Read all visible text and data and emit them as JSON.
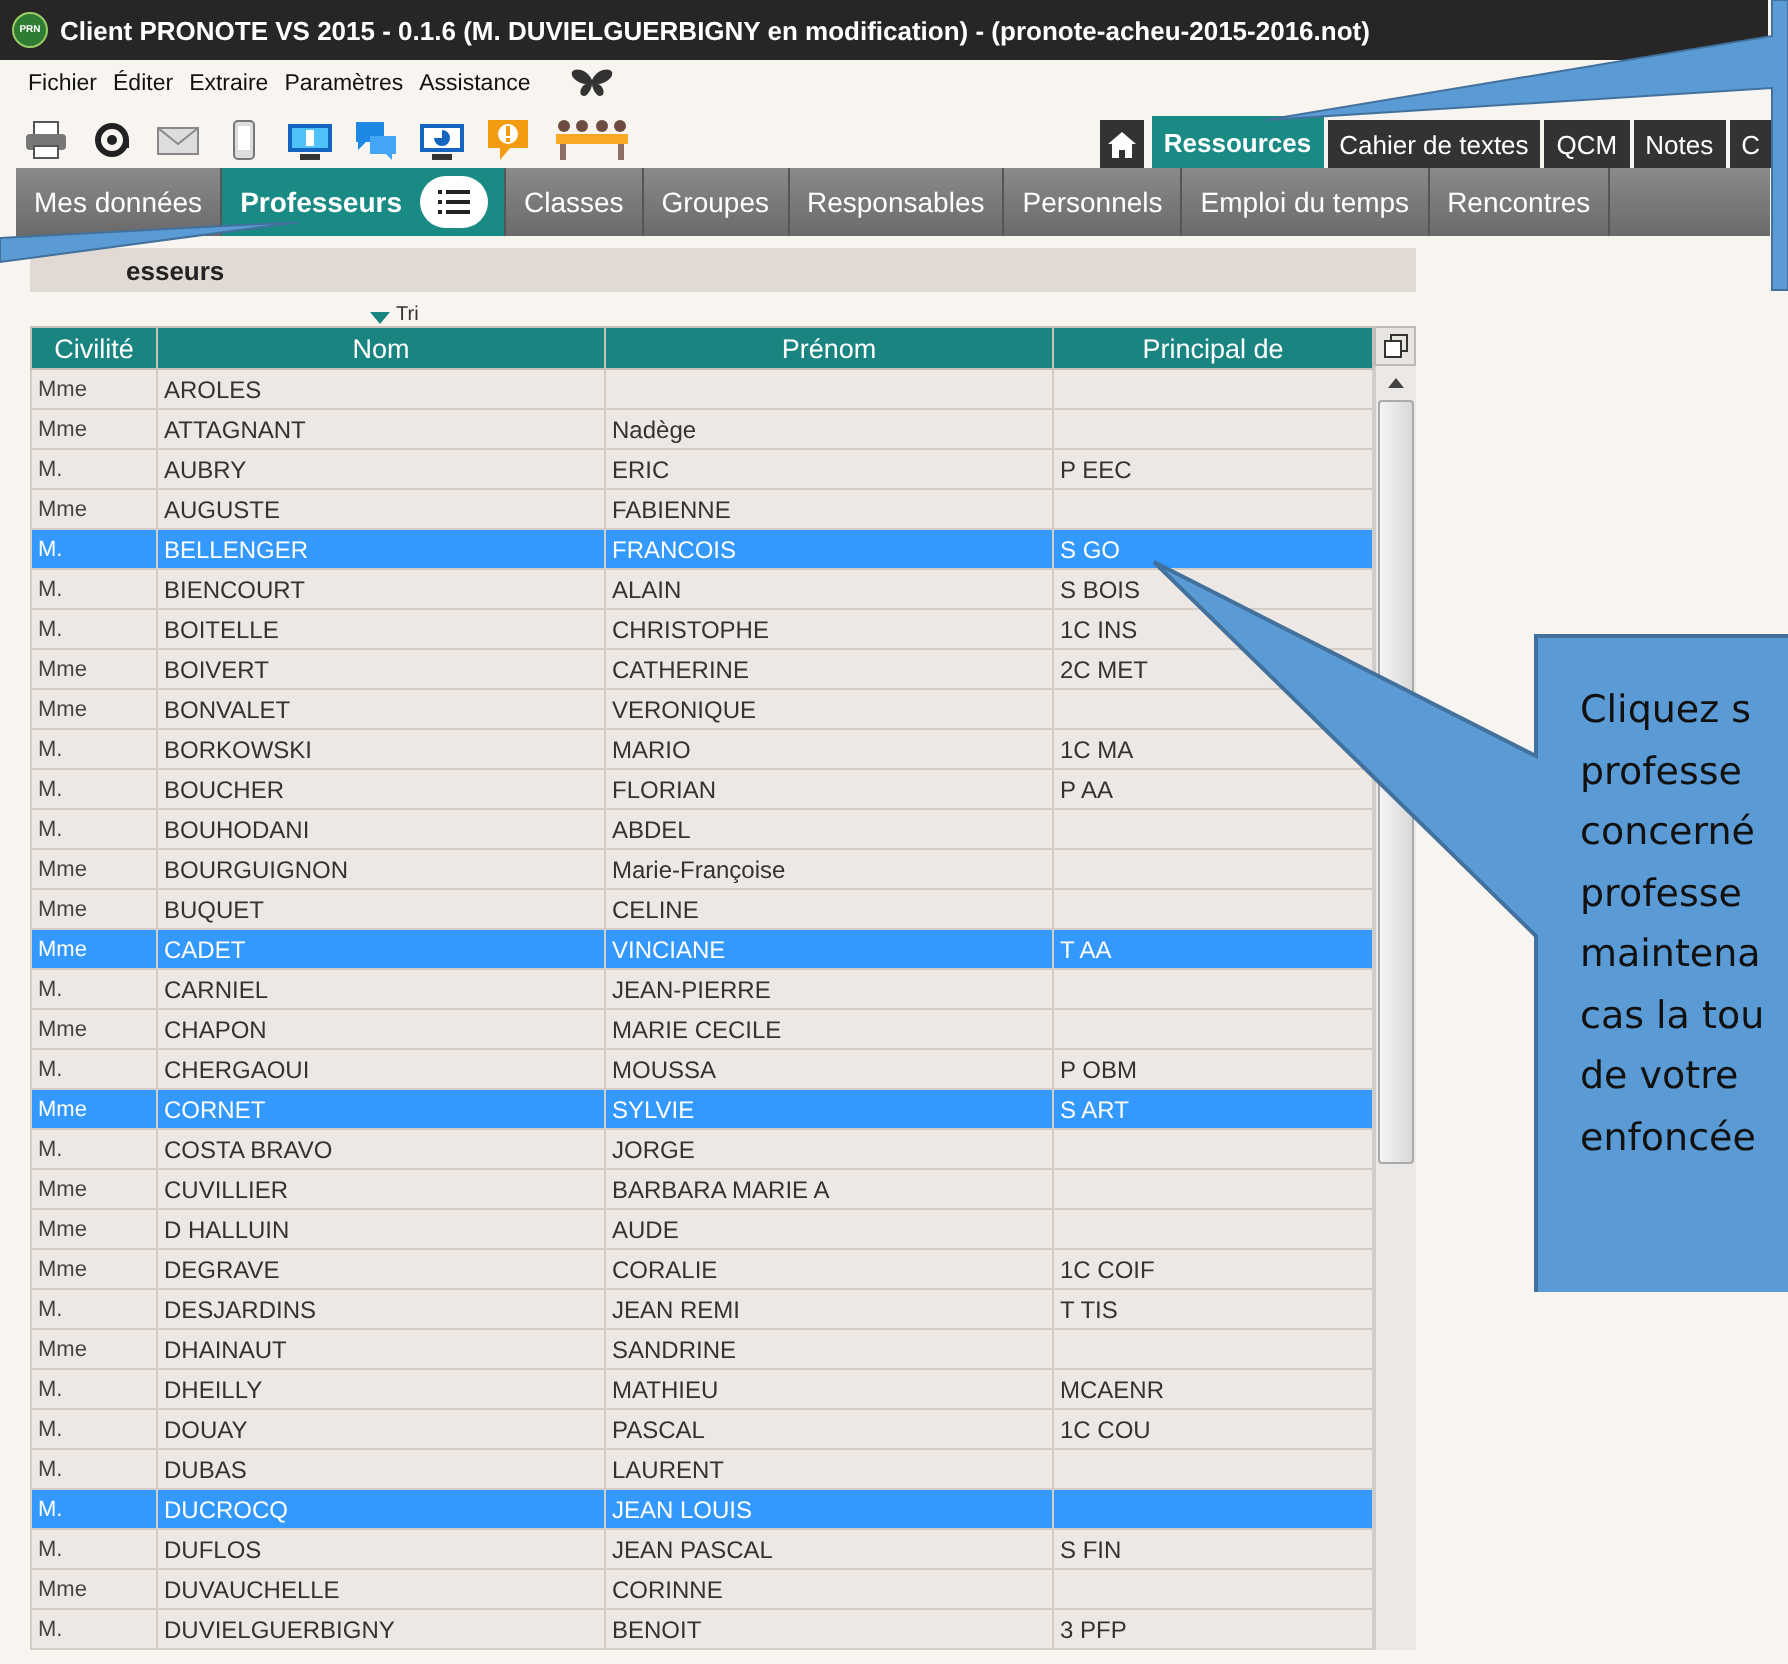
{
  "window": {
    "title": "Client PRONOTE VS 2015 - 0.1.6 (M. DUVIELGUERBIGNY en modification) - (pronote-acheu-2015-2016.not)",
    "logo": "PRN"
  },
  "menu": [
    "Fichier",
    "Éditer",
    "Extraire",
    "Paramètres",
    "Assistance"
  ],
  "top_tabs": [
    {
      "label": "Ressources",
      "selected": true
    },
    {
      "label": "Cahier de textes",
      "selected": false
    },
    {
      "label": "QCM",
      "selected": false
    },
    {
      "label": "Notes",
      "selected": false
    },
    {
      "label": "C",
      "selected": false
    }
  ],
  "nav_tabs": [
    {
      "label": "Mes données",
      "selected": false
    },
    {
      "label": "Professeurs",
      "selected": true
    },
    {
      "label": "Classes",
      "selected": false
    },
    {
      "label": "Groupes",
      "selected": false
    },
    {
      "label": "Responsables",
      "selected": false
    },
    {
      "label": "Personnels",
      "selected": false
    },
    {
      "label": "Emploi du temps",
      "selected": false
    },
    {
      "label": "Rencontres",
      "selected": false
    }
  ],
  "section": {
    "title": "esseurs"
  },
  "table": {
    "sort_label": "Tri",
    "columns": [
      "Civilité",
      "Nom",
      "Prénom",
      "Principal de"
    ],
    "rows": [
      {
        "cells": [
          "Mme",
          "AROLES",
          "",
          ""
        ],
        "selected": false
      },
      {
        "cells": [
          "Mme",
          "ATTAGNANT",
          "Nadège",
          ""
        ],
        "selected": false
      },
      {
        "cells": [
          "M.",
          "AUBRY",
          "ERIC",
          "P EEC"
        ],
        "selected": false
      },
      {
        "cells": [
          "Mme",
          "AUGUSTE",
          "FABIENNE",
          ""
        ],
        "selected": false
      },
      {
        "cells": [
          "M.",
          "BELLENGER",
          "FRANCOIS",
          "S GO"
        ],
        "selected": true
      },
      {
        "cells": [
          "M.",
          "BIENCOURT",
          "ALAIN",
          "S BOIS"
        ],
        "selected": false
      },
      {
        "cells": [
          "M.",
          "BOITELLE",
          "CHRISTOPHE",
          "1C INS"
        ],
        "selected": false
      },
      {
        "cells": [
          "Mme",
          "BOIVERT",
          "CATHERINE",
          "2C MET"
        ],
        "selected": false
      },
      {
        "cells": [
          "Mme",
          "BONVALET",
          "VERONIQUE",
          ""
        ],
        "selected": false
      },
      {
        "cells": [
          "M.",
          "BORKOWSKI",
          "MARIO",
          "1C MA"
        ],
        "selected": false
      },
      {
        "cells": [
          "M.",
          "BOUCHER",
          "FLORIAN",
          "P AA"
        ],
        "selected": false
      },
      {
        "cells": [
          "M.",
          "BOUHODANI",
          "ABDEL",
          ""
        ],
        "selected": false
      },
      {
        "cells": [
          "Mme",
          "BOURGUIGNON",
          "Marie-Françoise",
          ""
        ],
        "selected": false
      },
      {
        "cells": [
          "Mme",
          "BUQUET",
          "CELINE",
          ""
        ],
        "selected": false
      },
      {
        "cells": [
          "Mme",
          "CADET",
          "VINCIANE",
          "T AA"
        ],
        "selected": true
      },
      {
        "cells": [
          "M.",
          "CARNIEL",
          "JEAN-PIERRE",
          ""
        ],
        "selected": false
      },
      {
        "cells": [
          "Mme",
          "CHAPON",
          "MARIE CECILE",
          ""
        ],
        "selected": false
      },
      {
        "cells": [
          "M.",
          "CHERGAOUI",
          "MOUSSA",
          "P OBM"
        ],
        "selected": false
      },
      {
        "cells": [
          "Mme",
          "CORNET",
          "SYLVIE",
          "S ART"
        ],
        "selected": true
      },
      {
        "cells": [
          "M.",
          "COSTA BRAVO",
          "JORGE",
          ""
        ],
        "selected": false
      },
      {
        "cells": [
          "Mme",
          "CUVILLIER",
          "BARBARA MARIE A",
          ""
        ],
        "selected": false
      },
      {
        "cells": [
          "Mme",
          "D HALLUIN",
          "AUDE",
          ""
        ],
        "selected": false
      },
      {
        "cells": [
          "Mme",
          "DEGRAVE",
          "CORALIE",
          "1C COIF"
        ],
        "selected": false
      },
      {
        "cells": [
          "M.",
          "DESJARDINS",
          "JEAN REMI",
          "T TIS"
        ],
        "selected": false
      },
      {
        "cells": [
          "Mme",
          "DHAINAUT",
          "SANDRINE",
          ""
        ],
        "selected": false
      },
      {
        "cells": [
          "M.",
          "DHEILLY",
          "MATHIEU",
          "MCAENR"
        ],
        "selected": false
      },
      {
        "cells": [
          "M.",
          "DOUAY",
          "PASCAL",
          "1C COU"
        ],
        "selected": false
      },
      {
        "cells": [
          "M.",
          "DUBAS",
          "LAURENT",
          ""
        ],
        "selected": false
      },
      {
        "cells": [
          "M.",
          "DUCROCQ",
          "JEAN LOUIS",
          ""
        ],
        "selected": true
      },
      {
        "cells": [
          "M.",
          "DUFLOS",
          "JEAN PASCAL",
          "S FIN"
        ],
        "selected": false
      },
      {
        "cells": [
          "Mme",
          "DUVAUCHELLE",
          "CORINNE",
          ""
        ],
        "selected": false
      },
      {
        "cells": [
          "M.",
          "DUVIELGUERBIGNY",
          "BENOIT",
          "3 PFP"
        ],
        "selected": false
      }
    ]
  },
  "callout": {
    "lines": [
      "Cliquez s",
      "professe",
      "concerné",
      "professe",
      "maintena",
      "cas la tou",
      "de votre",
      "enfoncée"
    ]
  }
}
